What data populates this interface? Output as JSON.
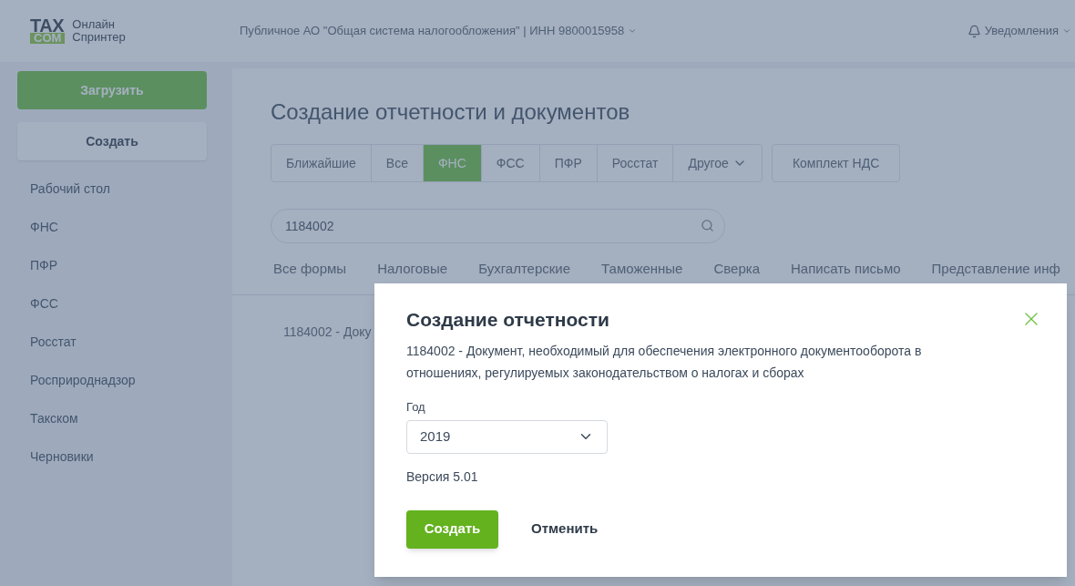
{
  "logo": {
    "mark_top": "TAX",
    "mark_bottom": "COM",
    "name_line1": "Онлайн",
    "name_line2": "Спринтер"
  },
  "header": {
    "organization": "Публичное АО \"Общая система налогообложения\" | ИНН 9800015958",
    "notifications": "Уведомления"
  },
  "sidebar": {
    "upload_button": "Загрузить",
    "create_button": "Создать",
    "items": [
      {
        "label": "Рабочий стол",
        "selected": false
      },
      {
        "label": "ФНС",
        "selected": false
      },
      {
        "label": "ПФР",
        "selected": false
      },
      {
        "label": "ФСС",
        "selected": false
      },
      {
        "label": "Росстат",
        "selected": false
      },
      {
        "label": "Росприроднадзор",
        "selected": false
      },
      {
        "label": "Такском",
        "selected": false
      },
      {
        "label": "Черновики",
        "selected": false
      }
    ]
  },
  "page": {
    "title": "Создание отчетности и документов",
    "agency_tabs": [
      {
        "label": "Ближайшие",
        "selected": false,
        "kind": "plain"
      },
      {
        "label": "Все",
        "selected": false,
        "kind": "plain"
      },
      {
        "label": "ФНС",
        "selected": true,
        "kind": "plain"
      },
      {
        "label": "ФСС",
        "selected": false,
        "kind": "plain"
      },
      {
        "label": "ПФР",
        "selected": false,
        "kind": "plain"
      },
      {
        "label": "Росстат",
        "selected": false,
        "kind": "plain"
      },
      {
        "label": "Другое",
        "selected": false,
        "kind": "dropdown"
      }
    ],
    "extra_tab": "Комплект НДС",
    "search": {
      "value": "1184002"
    },
    "form_tabs": [
      {
        "label": "Все формы",
        "selected": false
      },
      {
        "label": "Налоговые",
        "selected": false
      },
      {
        "label": "Бухгалтерские",
        "selected": false
      },
      {
        "label": "Таможенные",
        "selected": false
      },
      {
        "label": "Сверка",
        "selected": false
      },
      {
        "label": "Написать письмо",
        "selected": false
      },
      {
        "label": "Представление инф",
        "selected": false
      }
    ],
    "result_row": "1184002 - Доку"
  },
  "dialog": {
    "title": "Создание отчетности",
    "description": "1184002 - Документ, необходимый для обеспечения электронного документооборота в отношениях, регулируемых законодательством о налогах и сборах",
    "year_label": "Год",
    "year_value": "2019",
    "version": "Версия 5.01",
    "primary_button": "Создать",
    "cancel_button": "Отменить"
  }
}
